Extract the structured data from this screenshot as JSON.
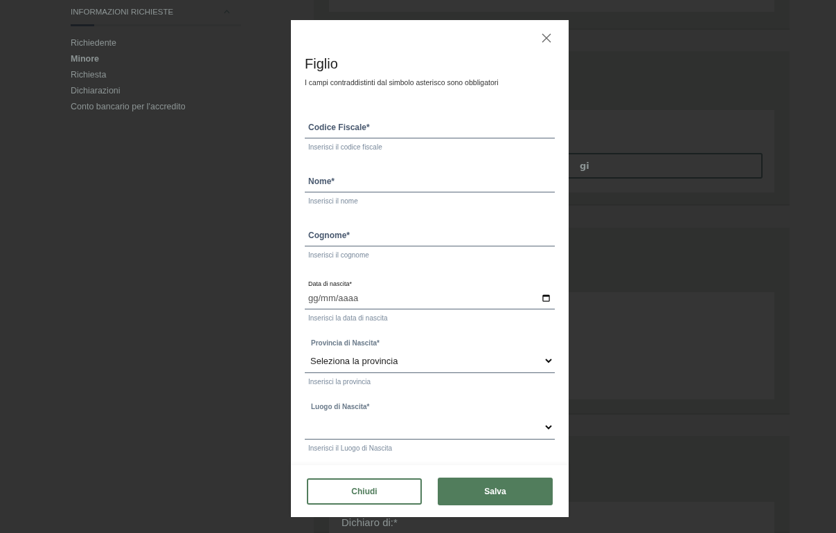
{
  "sidebar": {
    "heading": "INFORMAZIONI RICHIESTE",
    "progress": {
      "level": 0.14
    },
    "items": [
      {
        "label": "Richiedente",
        "selected": false
      },
      {
        "label": "Minore",
        "selected": true
      },
      {
        "label": "Richiesta",
        "selected": false
      },
      {
        "label": "Dichiarazioni",
        "selected": false
      },
      {
        "label": "Conto bancario per l'accredito",
        "selected": false
      }
    ]
  },
  "main": {
    "partial_field_value": "gi",
    "declaration_label": "Dichiaro di:*"
  },
  "modal": {
    "title": "Figlio",
    "subtitle": "I campi contraddistinti dal simbolo asterisco sono obbligatori",
    "fields": [
      {
        "kind": "text",
        "label": "Codice Fiscale*",
        "hint": "Inserisci il codice fiscale"
      },
      {
        "kind": "text",
        "label": "Nome*",
        "hint": "Inserisci il nome"
      },
      {
        "kind": "text",
        "label": "Cognome*",
        "hint": "Inserisci il cognome"
      },
      {
        "kind": "date",
        "label": "Data di nascita*",
        "placeholder": "gg/mm/aaaa",
        "hint": "Inserisci la data di nascita"
      },
      {
        "kind": "select",
        "label": "Provincia di Nascita*",
        "value": "Seleziona la provincia",
        "hint": "Inserisci la provincia"
      },
      {
        "kind": "select",
        "label": "Luogo di Nascita*",
        "hint": "Inserisci il Luogo di Nascita"
      }
    ],
    "buttons": [
      {
        "kind": "secondary",
        "label": "Chiudi"
      },
      {
        "kind": "primary",
        "label": "Salva"
      }
    ]
  }
}
